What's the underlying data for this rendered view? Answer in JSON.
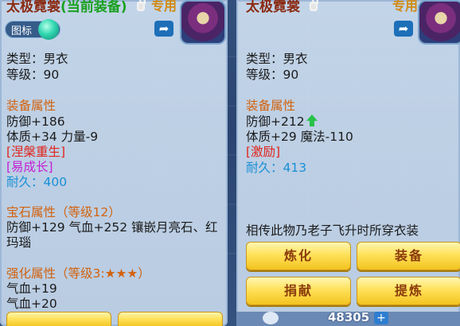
{
  "left": {
    "title": "太极霓裳",
    "current_tag": "(当前装备)",
    "special": "专用",
    "toggle_label": "图标",
    "type_line": "类型：男衣",
    "level_line": "等级：90",
    "attr_header": "装备属性",
    "defense": "防御+186",
    "stats": "体质+34 力量-9",
    "special1": "[涅槃重生]",
    "special2": "[易成长]",
    "durability_label": "耐久：",
    "durability_value": "400",
    "gem_header": "宝石属性（等级12）",
    "gem_line1": "防御+129 气血+252 镶嵌月亮石、红",
    "gem_line2": "玛瑙",
    "enhance_header": "强化属性（等级3:★★★）",
    "enhance_line1": "气血+19",
    "enhance_line2": "气血+20"
  },
  "right": {
    "title": "太极霓裳",
    "special": "专用",
    "type_line": "类型：男衣",
    "level_line": "等级：90",
    "attr_header": "装备属性",
    "defense": "防御+212",
    "stats": "体质+29 魔法-110",
    "special1": "[激励]",
    "durability_label": "耐久：",
    "durability_value": "413",
    "description": "相传此物乃老子飞升时所穿衣装",
    "buttons": [
      "炼化",
      "装备",
      "捐献",
      "提炼"
    ]
  },
  "footer": {
    "money": "48305"
  }
}
